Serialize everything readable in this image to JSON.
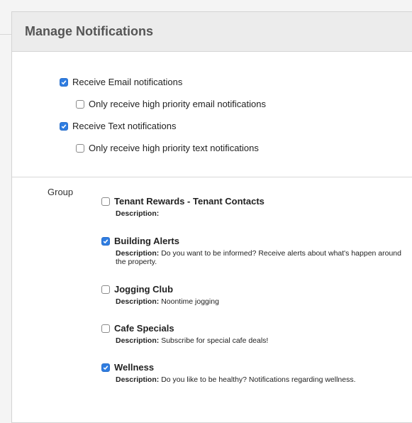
{
  "panel": {
    "title": "Manage Notifications"
  },
  "options": [
    {
      "label": "Receive Email notifications",
      "checked": true
    },
    {
      "label": "Only receive high priority email notifications",
      "checked": false
    },
    {
      "label": "Receive Text notifications",
      "checked": true
    },
    {
      "label": "Only receive high priority text notifications",
      "checked": false
    }
  ],
  "groups": {
    "label": "Group",
    "description_label": "Description:",
    "items": [
      {
        "name": "Tenant Rewards - Tenant Contacts",
        "checked": false,
        "description": ""
      },
      {
        "name": "Building Alerts",
        "checked": true,
        "description": "Do you want to be informed? Receive alerts about what's happen around the property."
      },
      {
        "name": "Jogging Club",
        "checked": false,
        "description": "Noontime jogging"
      },
      {
        "name": "Cafe Specials",
        "checked": false,
        "description": "Subscribe for special cafe deals!"
      },
      {
        "name": "Wellness",
        "checked": true,
        "description": "Do you like to be healthy? Notifications regarding wellness."
      }
    ]
  },
  "colors": {
    "accent": "#2f7de1",
    "header_bg": "#ececec",
    "title": "#555555"
  }
}
